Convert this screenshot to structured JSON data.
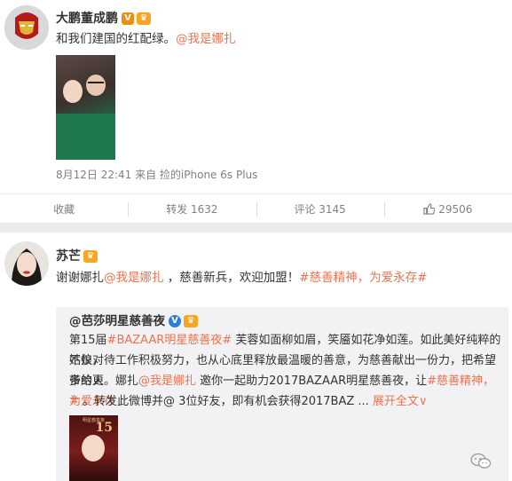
{
  "post1": {
    "author": "大鹏董成鹏",
    "badge": "V",
    "crown": "♛",
    "text_before": "和我们建国的红配绿。",
    "mention": "@我是娜扎",
    "meta": "8月12日 22:41 来自 捡的iPhone 6s Plus",
    "actions": {
      "collect": "收藏",
      "repost": "转发 1632",
      "comment": "评论 3145",
      "like": "29506"
    }
  },
  "post2": {
    "author": "苏芒",
    "crown": "♛",
    "text": {
      "p1": "谢谢娜扎",
      "mention": "@我是娜扎",
      "p2": " ，慈善新兵，欢迎加盟！",
      "tag": "#慈善精神，为爱永存#"
    },
    "quoted": {
      "author": "@芭莎明星慈善夜",
      "badge": "V",
      "crown": "♛",
      "line1_prefix": "第15届",
      "line1_tag": "#BAZAAR明星慈善夜#",
      "line1_rest": " 芙蓉如面柳如眉，笑靥如花净如莲。如此美好纯粹的姑娘，",
      "line2": "不仅对待工作积极努力，也从心底里释放最温暖的善意，为慈善献出一份力，把希望带给更",
      "line3_a": "多的人。娜扎",
      "line3_mention": "@我是娜扎",
      "line3_b": " 邀你一起助力2017BAZAAR明星慈善夜，让",
      "line3_tag": "#慈善精神，为爱永存",
      "line4_a": "#",
      "line4_b": " 。转发此微博并@ 3位好友，即有机会获得2017BAZ ...",
      "expand": "展开全文",
      "expand_icon": "∨",
      "poster_number": "15",
      "poster_top": "明星慈善夜"
    }
  },
  "icons": {
    "like": "thumb-up-icon",
    "wechat": "wechat-icon"
  }
}
